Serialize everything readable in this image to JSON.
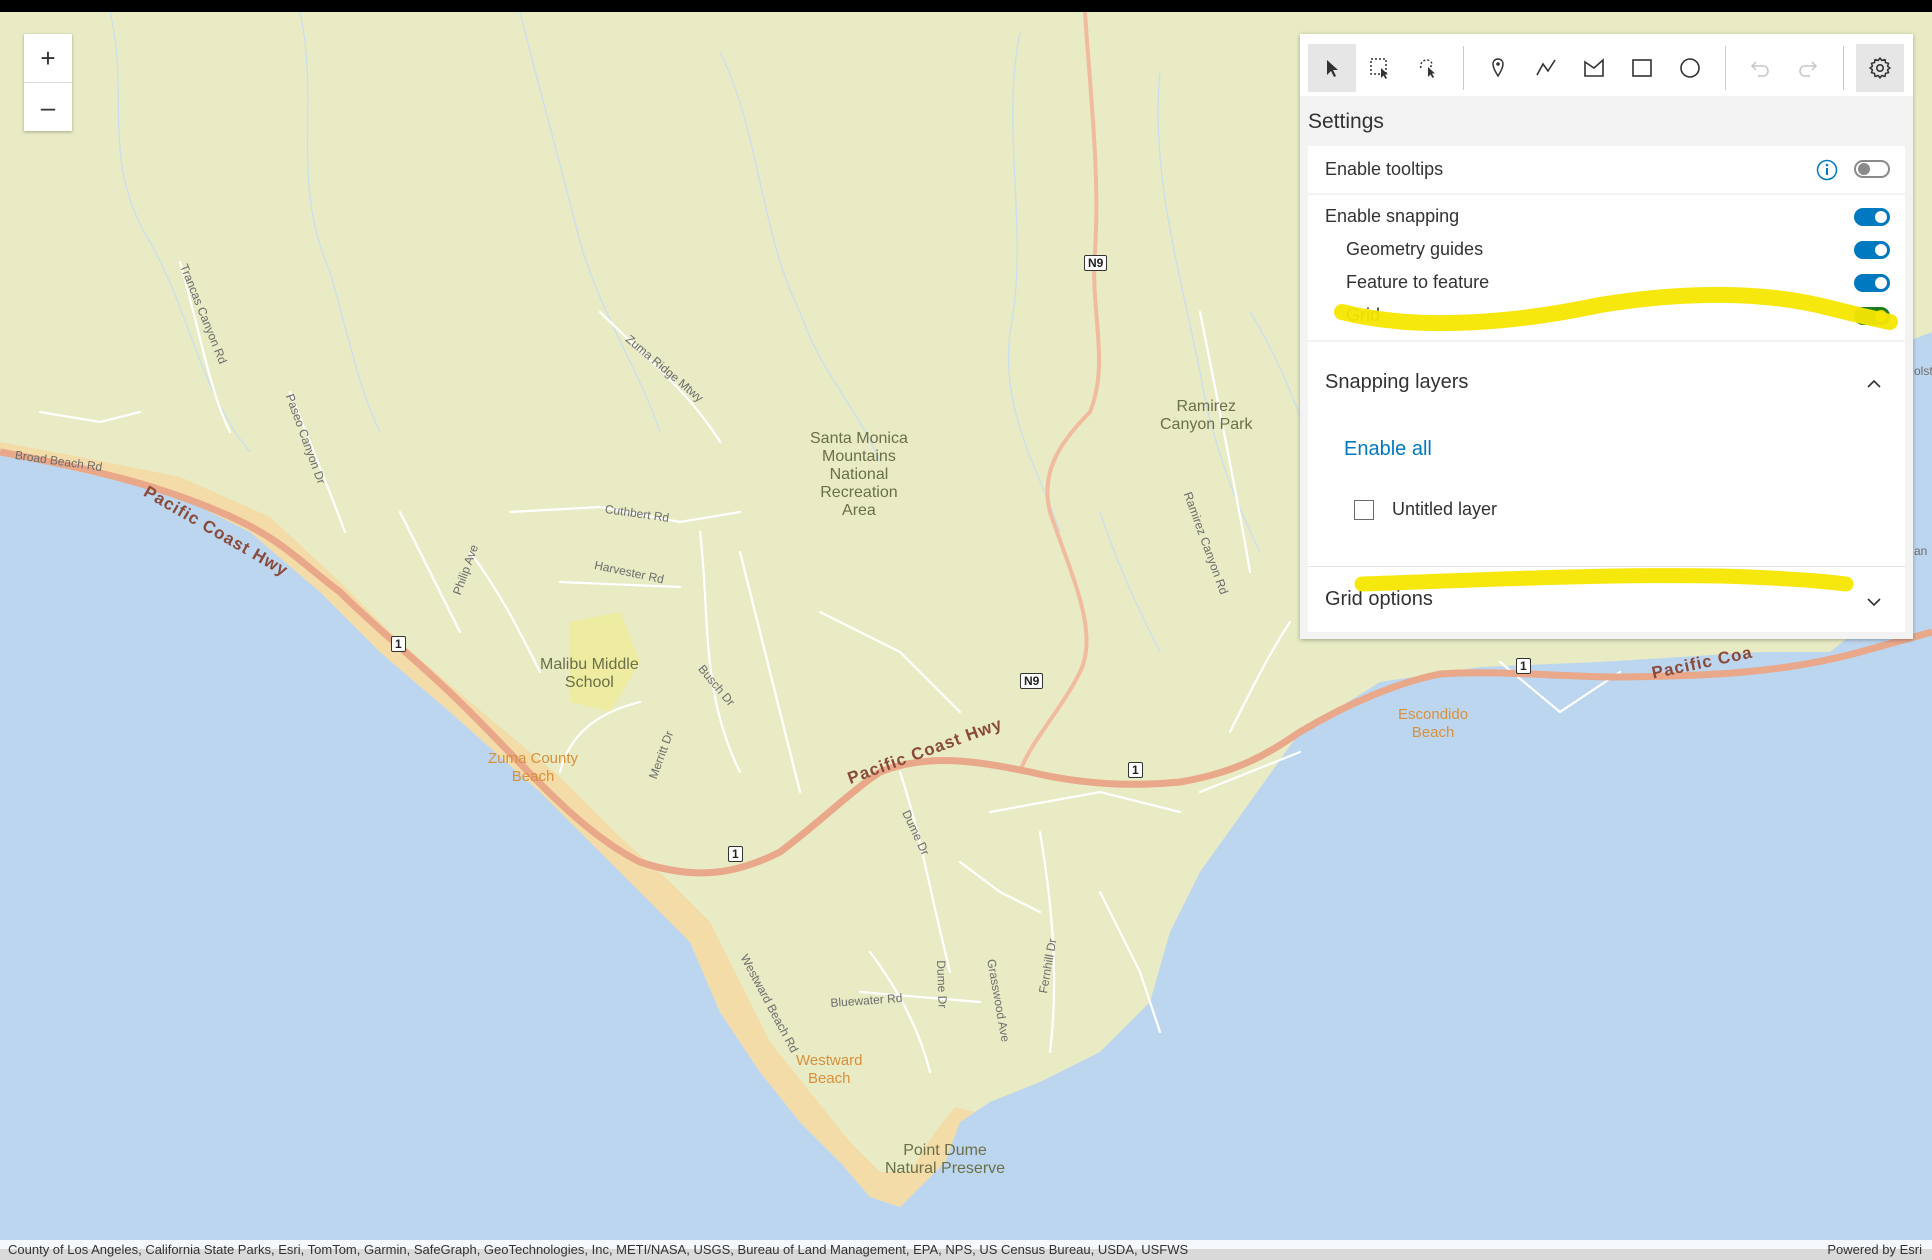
{
  "map": {
    "zoom_in": "+",
    "zoom_out": "–",
    "labels": {
      "park": "Santa Monica\nMountains\nNational\nRecreation\nArea",
      "ramirez_park": "Ramirez\nCanyon Park",
      "school": "Malibu Middle\nSchool",
      "zuma": "Zuma County\nBeach",
      "westward": "Westward\nBeach",
      "escondido": "Escondido\nBeach",
      "point_dume": "Point Dume\nNatural Preserve",
      "pch1": "Pacific Coast Hwy",
      "pch2": "Pacific Coast Hwy",
      "pch3": "Pacific Coa",
      "broad_beach": "Broad Beach Rd",
      "trancas": "Trancas Canyon Rd",
      "paseo": "Paseo Canyon Dr",
      "zuma_ridge": "Zuma Ridge Mtwy",
      "cuthbert": "Cuthbert Rd",
      "philip": "Philip Ave",
      "harvester": "Harvester Rd",
      "busch": "Busch Dr",
      "merritt": "Merritt Dr",
      "dume": "Dume Dr",
      "westward_rd": "Westward Beach Rd",
      "bluewater": "Bluewater Rd",
      "dume_dr2": "Dume Dr",
      "grasswood": "Grasswood Ave",
      "fernhill": "Fernhill Dr",
      "ramirez_rd": "Ramirez Canyon Rd",
      "edge1": "olst",
      "edge2": "an"
    },
    "shields": {
      "n9_top": "N9",
      "n9_mid": "N9",
      "r1_a": "1",
      "r1_b": "1",
      "r1_c": "1",
      "r1_d": "1"
    },
    "attribution": "County of Los Angeles, California State Parks, Esri, TomTom, Garmin, SafeGraph, GeoTechnologies, Inc, METI/NASA, USGS, Bureau of Land Management, EPA, NPS, US Census Bureau, USDA, USFWS",
    "powered_by": "Powered by Esri"
  },
  "toolbar": {
    "tools": [
      {
        "name": "select",
        "icon": "cursor-icon"
      },
      {
        "name": "rectangle-select",
        "icon": "rectangle-select-icon"
      },
      {
        "name": "lasso-select",
        "icon": "lasso-select-icon"
      },
      {
        "name": "point",
        "icon": "pin-icon"
      },
      {
        "name": "polyline",
        "icon": "polyline-icon"
      },
      {
        "name": "polygon",
        "icon": "polygon-icon"
      },
      {
        "name": "rectangle",
        "icon": "rectangle-icon"
      },
      {
        "name": "circle",
        "icon": "circle-icon"
      },
      {
        "name": "undo",
        "icon": "undo-icon"
      },
      {
        "name": "redo",
        "icon": "redo-icon"
      },
      {
        "name": "settings",
        "icon": "gear-icon"
      }
    ]
  },
  "settings": {
    "title": "Settings",
    "tooltips_label": "Enable tooltips",
    "snapping_label": "Enable snapping",
    "geometry_guides_label": "Geometry guides",
    "feature_to_feature_label": "Feature to feature",
    "grid_label": "Grid",
    "snapping_layers_title": "Snapping layers",
    "enable_all": "Enable all",
    "layer_name": "Untitled layer",
    "grid_options_title": "Grid options",
    "toggles": {
      "tooltips": "off",
      "snapping": "on",
      "geometry_guides": "on",
      "feature_to_feature": "on",
      "grid": "on"
    },
    "colors": {
      "accent": "#0079c1",
      "highlight": "#f5e600",
      "grid_toggle": "#1e7b1e"
    }
  }
}
